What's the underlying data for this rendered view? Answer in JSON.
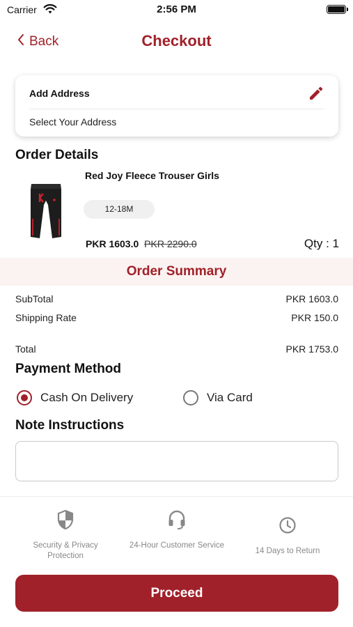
{
  "status_bar": {
    "carrier": "Carrier",
    "time": "2:56 PM"
  },
  "nav": {
    "back_label": "Back",
    "title": "Checkout"
  },
  "address": {
    "title": "Add Address",
    "value": "Select Your Address"
  },
  "order_details": {
    "heading": "Order Details",
    "item": {
      "name": "Red Joy Fleece Trouser Girls",
      "size": "12-18M",
      "price": "PKR 1603.0",
      "old_price": "PKR 2290.0",
      "qty": "Qty : 1"
    }
  },
  "summary": {
    "title": "Order Summary",
    "rows": [
      {
        "label": "SubTotal",
        "value": "PKR 1603.0"
      },
      {
        "label": "Shipping Rate",
        "value": "PKR 150.0"
      },
      {
        "label": "Total",
        "value": "PKR 1753.0"
      }
    ]
  },
  "payment": {
    "heading": "Payment Method",
    "options": [
      {
        "label": "Cash On Delivery",
        "selected": true
      },
      {
        "label": "Via Card",
        "selected": false
      }
    ]
  },
  "note": {
    "heading": "Note Instructions",
    "value": "",
    "placeholder": ""
  },
  "features": [
    {
      "icon": "shield-icon",
      "label": "Security & Privacy Protection"
    },
    {
      "icon": "headset-icon",
      "label": "24-Hour Customer Service"
    },
    {
      "icon": "clock-icon",
      "label": "14 Days to Return"
    }
  ],
  "proceed_label": "Proceed",
  "colors": {
    "accent": "#a0212a",
    "summary_band": "#fbf3f1"
  }
}
